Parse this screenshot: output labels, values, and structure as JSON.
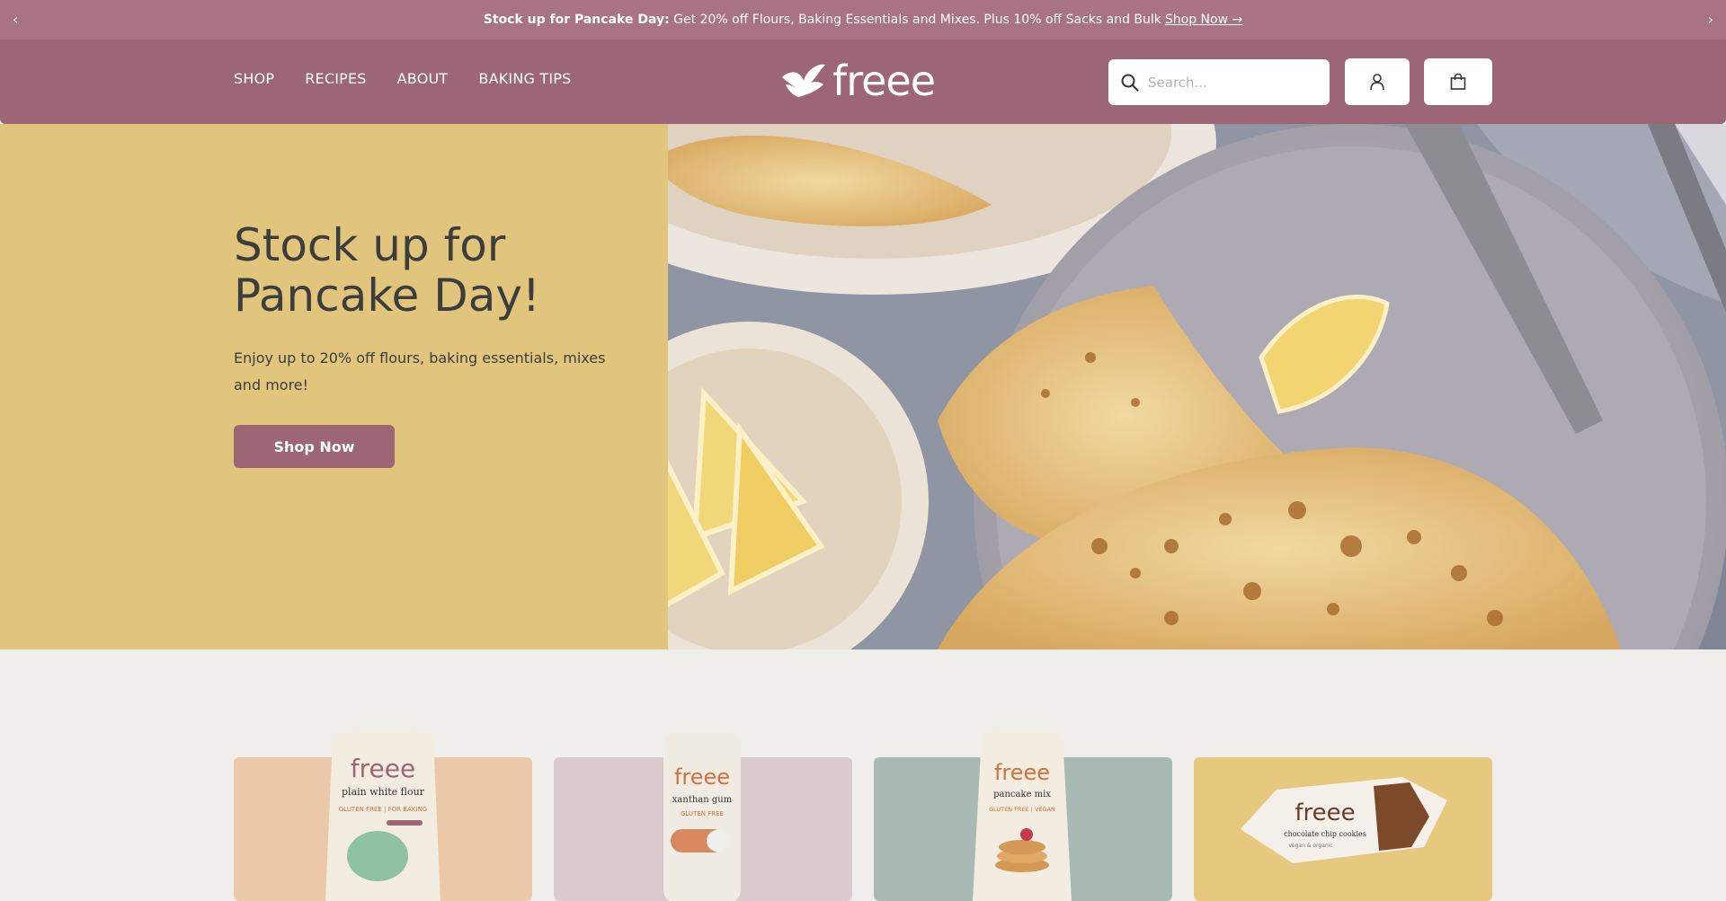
{
  "announcement": {
    "bold": "Stock up for Pancake Day:",
    "text": " Get 20% off Flours, Baking Essentials and Mixes. Plus 10% off Sacks and Bulk",
    "link": "Shop Now →",
    "prev": "‹",
    "next": "›"
  },
  "nav": {
    "items": [
      "SHOP",
      "RECIPES",
      "ABOUT",
      "BAKING TIPS"
    ]
  },
  "logo": {
    "text": "freee"
  },
  "search": {
    "placeholder": "Search..."
  },
  "hero": {
    "title": "Stock up for Pancake Day!",
    "subtitle": "Enjoy up to 20% off flours, baking essentials, mixes and more!",
    "button": "Shop Now"
  },
  "products": [
    {
      "brand": "freee",
      "name": "plain white flour",
      "tag": "GLUTEN FREE | FOR BAKING",
      "bg": "#ebc8a7"
    },
    {
      "brand": "freee",
      "name": "xanthan gum",
      "tag": "GLUTEN FREE",
      "bg": "#d9cacd"
    },
    {
      "brand": "freee",
      "name": "pancake mix",
      "tag": "GLUTEN FREE | VEGAN",
      "bg": "#a9bab4"
    },
    {
      "brand": "freee",
      "name": "chocolate chip cookies",
      "tag": "vegan & organic",
      "bg": "#e6c97f"
    }
  ],
  "colors": {
    "announce": "#a87383",
    "header": "#9c6676",
    "hero_left": "#e2c57c",
    "page_bg": "#efeeeb"
  }
}
